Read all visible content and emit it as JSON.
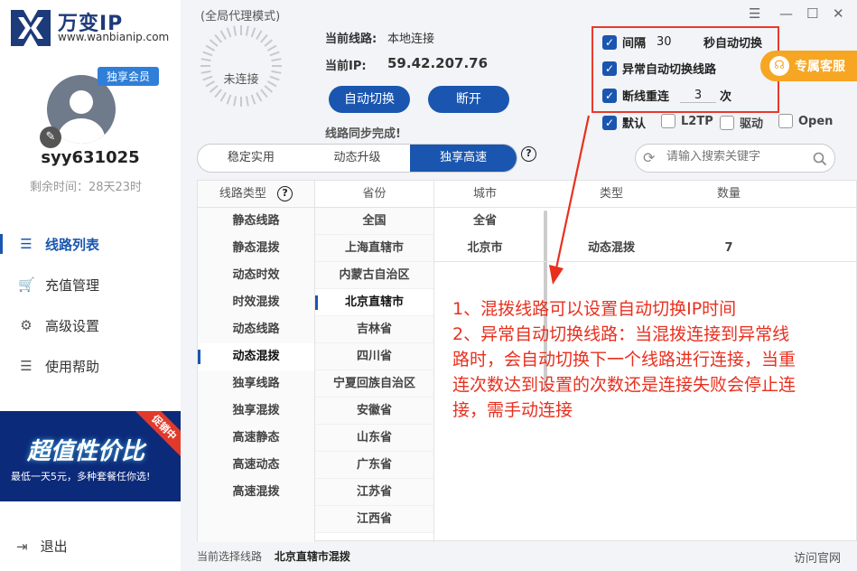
{
  "brand": {
    "name": "万变IP",
    "url": "www.wanbianip.com"
  },
  "user": {
    "badge": "独享会员",
    "name": "syy631025",
    "remaining": "剩余时间：28天23时"
  },
  "nav": [
    {
      "label": "线路列表",
      "icon": "list-icon"
    },
    {
      "label": "充值管理",
      "icon": "cart-icon"
    },
    {
      "label": "高级设置",
      "icon": "gear-icon"
    },
    {
      "label": "使用帮助",
      "icon": "help-list-icon"
    }
  ],
  "banner": {
    "title": "超值性价比",
    "subtitle": "最低一天5元，多种套餐任你选!",
    "ribbon": "促销中"
  },
  "logout": "退出",
  "header": {
    "mode": "(全局代理模式)",
    "status": "未连接",
    "current_line_label": "当前线路:",
    "current_line_value": "本地连接",
    "current_ip_label": "当前IP:",
    "current_ip_value": "59.42.207.76",
    "auto_switch": "自动切换",
    "disconnect": "断开",
    "sync": "线路同步完成!"
  },
  "options": {
    "interval_label": "间隔",
    "interval_value": "30",
    "interval_suffix": "秒自动切换",
    "auto_abnormal": "异常自动切换线路",
    "retry_label": "断线重连",
    "retry_value": "3",
    "retry_suffix": "次",
    "protocols": [
      "默认",
      "L2TP",
      "驱动",
      "Open"
    ]
  },
  "service": "专属客服",
  "tabs": [
    "稳定实用",
    "动态升级",
    "独享高速"
  ],
  "search_placeholder": "请输入搜索关键字",
  "table": {
    "headers": {
      "line_type": "线路类型",
      "province": "省份",
      "city": "城市",
      "type": "类型",
      "count": "数量"
    },
    "line_types": [
      "静态线路",
      "静态混拨",
      "动态时效",
      "时效混拨",
      "动态线路",
      "动态混拨",
      "独享线路",
      "独享混拨",
      "高速静态",
      "高速动态",
      "高速混拨"
    ],
    "provinces": [
      "全国",
      "上海直辖市",
      "内蒙古自治区",
      "北京直辖市",
      "吉林省",
      "四川省",
      "宁夏回族自治区",
      "安徽省",
      "山东省",
      "广东省",
      "江苏省",
      "江西省"
    ],
    "cities": [
      {
        "city": "全省",
        "type": "",
        "count": ""
      },
      {
        "city": "北京市",
        "type": "动态混拨",
        "count": "7"
      }
    ]
  },
  "annotation": "1、混拨线路可以设置自动切换IP时间\n2、异常自动切换线路：当混拨连接到异常线路时，会自动切换下一个线路进行连接，当重连次数达到设置的次数还是连接失败会停止连接，需手动连接",
  "annotation_lines": [
    "1、混拨线路可以设置自动切换IP时间",
    "2、异常自动切换线路：当混拨连接到异常线",
    "路时，会自动切换下一个线路进行连接，当重",
    "连次数达到设置的次数还是连接失败会停止连",
    "接，需手动连接"
  ],
  "statusbar": {
    "label": "当前选择线路",
    "value": "北京直辖市混拨"
  },
  "site_link": "访问官网",
  "colors": {
    "primary": "#1a56b0",
    "accent": "#f6a623",
    "annotation": "#e8301f"
  }
}
